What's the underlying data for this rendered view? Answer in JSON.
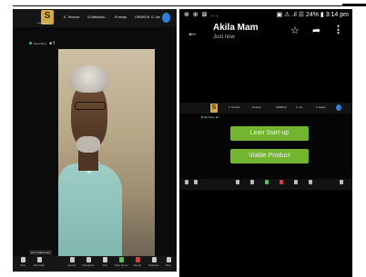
{
  "left": {
    "logo_letter": "S",
    "logo_caption": "S deployment",
    "participants": [
      "K. Tennoch",
      "S.Sathishkri...",
      "R.ramya",
      "GRIMIS M",
      "G. Jim"
    ],
    "recording_label": "Recording",
    "speaker_name": "Devi Subramani",
    "toolbar": [
      {
        "label": "Mute",
        "icon": "mic-icon",
        "color": "#c9c9c9"
      },
      {
        "label": "Start Video",
        "icon": "video-icon",
        "color": "#c9c9c9"
      },
      {
        "label": "Security",
        "icon": "shield-icon",
        "color": "#c9c9c9"
      },
      {
        "label": "Participants",
        "icon": "participants-icon",
        "color": "#c9c9c9"
      },
      {
        "label": "Chat",
        "icon": "chat-icon",
        "color": "#c9c9c9"
      },
      {
        "label": "Share Screen",
        "icon": "share-screen-icon",
        "color": "#43c65a"
      },
      {
        "label": "Record",
        "icon": "record-icon",
        "color": "#e23b3b"
      },
      {
        "label": "Reactions",
        "icon": "reactions-icon",
        "color": "#c9c9c9"
      },
      {
        "label": "More",
        "icon": "more-icon",
        "color": "#c9c9c9"
      }
    ]
  },
  "right": {
    "status_left": "⊕ ⊕ ⊠ ...",
    "status_right": "▣ ⚠ .ıl ☰ 24% ▮ 3:14 pm",
    "title": "Akila Mam",
    "subtitle": "Just now",
    "shot": {
      "logo_letter": "S",
      "participants": [
        "K. Tennoch",
        "R.ramya",
        "GRIMIS M",
        "G. Jim",
        "S. Deepa"
      ],
      "recording_label": "Recording",
      "buttons": [
        "Lean Start-up",
        "Viable Product"
      ]
    }
  },
  "colors": {
    "accent_green": "#73b52f",
    "record_red": "#e23b3b",
    "avatar_blue": "#2d7fdc",
    "logo_gold": "#d2aa46"
  }
}
